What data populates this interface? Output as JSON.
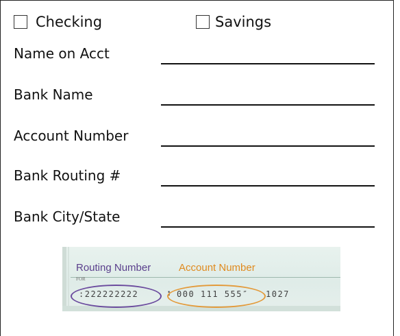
{
  "account_type": {
    "options": [
      {
        "label": "Checking",
        "checked": false
      },
      {
        "label": "Savings",
        "checked": false
      }
    ]
  },
  "fields": [
    {
      "label": "Name on Acct",
      "value": ""
    },
    {
      "label": "Bank Name",
      "value": ""
    },
    {
      "label": "Account Number",
      "value": ""
    },
    {
      "label": "Bank Routing #",
      "value": ""
    },
    {
      "label": "Bank City/State",
      "value": ""
    }
  ],
  "check_example": {
    "routing_title": "Routing Number",
    "account_title": "Account Number",
    "for_label": "FOR",
    "micr_routing": ":222222222",
    "micr_separator": ":",
    "micr_account": "000 111 555″",
    "micr_check": "1027",
    "colors": {
      "routing": "#6b4b9e",
      "account": "#e39a3a"
    }
  }
}
